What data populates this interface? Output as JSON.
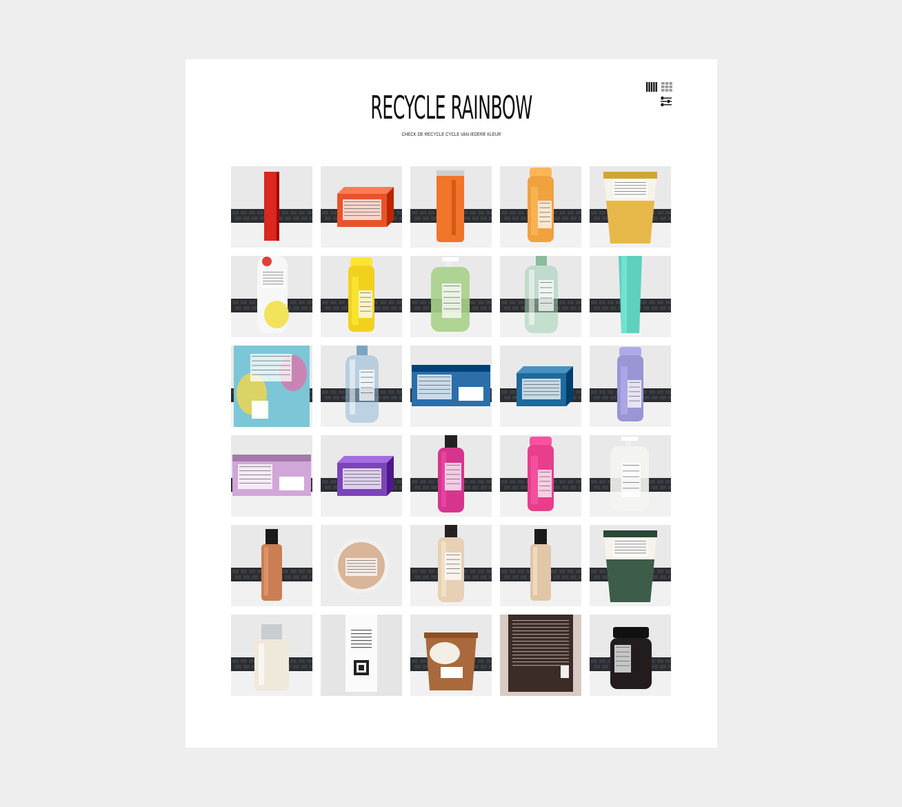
{
  "header": {
    "title": "RECYCLE RAINBOW",
    "subtitle": "CHECK DE RECYCLE CYCLE VAN IEDERE KLEUR"
  },
  "view_controls": [
    {
      "name": "columns-view-icon",
      "active": true
    },
    {
      "name": "grid-view-icon",
      "active": false
    },
    {
      "name": "filter-sliders-icon"
    }
  ],
  "colors": {
    "page_bg": "#eeeeee",
    "card_bg": "#ffffff",
    "text": "#111111",
    "icon_active": "#111111",
    "icon_inactive": "#9a9a9a"
  },
  "gallery": [
    {
      "item": "red-box",
      "color": "#d8281f",
      "shape": "tall-box"
    },
    {
      "item": "orange-box",
      "color": "#e8532c",
      "shape": "box"
    },
    {
      "item": "orange-can",
      "color": "#f0742a",
      "shape": "can"
    },
    {
      "item": "orange-spray",
      "color": "#f0a140",
      "shape": "spray"
    },
    {
      "item": "yellow-cup",
      "color": "#e6b84a",
      "shape": "cup"
    },
    {
      "item": "yellow-white-bottle",
      "color": "#f3e35a",
      "shape": "bottle-white"
    },
    {
      "item": "yellow-spray",
      "color": "#f2d11e",
      "shape": "spray"
    },
    {
      "item": "green-soap",
      "color": "#a8d08a",
      "shape": "pump"
    },
    {
      "item": "green-clear-bottle",
      "color": "#9fcfb0",
      "shape": "bottle-clear"
    },
    {
      "item": "teal-tube",
      "color": "#5fcfbe",
      "shape": "tube"
    },
    {
      "item": "blue-carton",
      "color": "#7cc6d8",
      "shape": "carton"
    },
    {
      "item": "blue-water-bottle",
      "color": "#8fb8d6",
      "shape": "bottle-clear"
    },
    {
      "item": "blue-pack",
      "color": "#2b6ea8",
      "shape": "flat-pack"
    },
    {
      "item": "blue-box",
      "color": "#1f6a9a",
      "shape": "box"
    },
    {
      "item": "lavender-spray",
      "color": "#9a95d4",
      "shape": "spray"
    },
    {
      "item": "pastel-pack",
      "color": "#d1a6d8",
      "shape": "flat-pack"
    },
    {
      "item": "purple-box",
      "color": "#7b45b8",
      "shape": "box"
    },
    {
      "item": "magenta-bottle",
      "color": "#d6358e",
      "shape": "bottle"
    },
    {
      "item": "pink-spray",
      "color": "#e83e8c",
      "shape": "spray"
    },
    {
      "item": "white-pump",
      "color": "#f4f4f2",
      "shape": "pump"
    },
    {
      "item": "amber-bottle",
      "color": "#c97f53",
      "shape": "bottle-dark-cap"
    },
    {
      "item": "beige-compact",
      "color": "#d9b59a",
      "shape": "compact"
    },
    {
      "item": "nude-foundation",
      "color": "#e7d0b5",
      "shape": "bottle"
    },
    {
      "item": "nude-foundation-2",
      "color": "#e1c6a8",
      "shape": "bottle-dark-cap"
    },
    {
      "item": "green-tub",
      "color": "#3d5c4a",
      "shape": "cup"
    },
    {
      "item": "cream-bottle",
      "color": "#efe9dc",
      "shape": "bottle-square"
    },
    {
      "item": "white-tag",
      "color": "#fbfbfb",
      "shape": "tag"
    },
    {
      "item": "brown-tub",
      "color": "#a9693c",
      "shape": "tub"
    },
    {
      "item": "dark-brown-box",
      "color": "#3c2c27",
      "shape": "flat-dark"
    },
    {
      "item": "black-jar",
      "color": "#231c1e",
      "shape": "jar"
    }
  ]
}
